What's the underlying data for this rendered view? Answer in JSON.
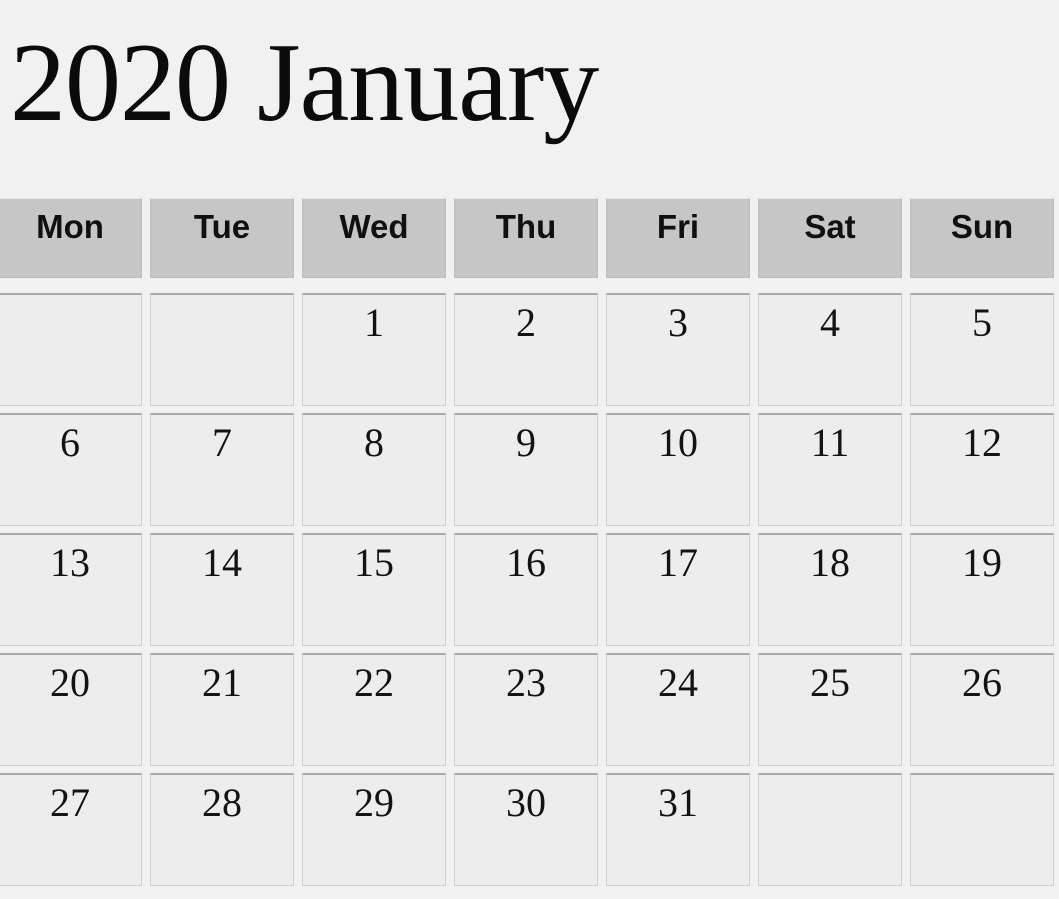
{
  "title": "2020 January",
  "year": "2020",
  "month": "January",
  "colors": {
    "page_background": "#f1f1f1",
    "header_cell_background": "#c6c6c6",
    "day_cell_background": "#ededed",
    "cell_border": "#cfcfcf",
    "text": "#131313"
  },
  "weekday_headers": [
    {
      "label": "Mon"
    },
    {
      "label": "Tue"
    },
    {
      "label": "Wed"
    },
    {
      "label": "Thu"
    },
    {
      "label": "Fri"
    },
    {
      "label": "Sat"
    },
    {
      "label": "Sun"
    }
  ],
  "weeks": [
    {
      "days": [
        {
          "num": ""
        },
        {
          "num": ""
        },
        {
          "num": "1"
        },
        {
          "num": "2"
        },
        {
          "num": "3"
        },
        {
          "num": "4"
        },
        {
          "num": "5"
        }
      ]
    },
    {
      "days": [
        {
          "num": "6"
        },
        {
          "num": "7"
        },
        {
          "num": "8"
        },
        {
          "num": "9"
        },
        {
          "num": "10"
        },
        {
          "num": "11"
        },
        {
          "num": "12"
        }
      ]
    },
    {
      "days": [
        {
          "num": "13"
        },
        {
          "num": "14"
        },
        {
          "num": "15"
        },
        {
          "num": "16"
        },
        {
          "num": "17"
        },
        {
          "num": "18"
        },
        {
          "num": "19"
        }
      ]
    },
    {
      "days": [
        {
          "num": "20"
        },
        {
          "num": "21"
        },
        {
          "num": "22"
        },
        {
          "num": "23"
        },
        {
          "num": "24"
        },
        {
          "num": "25"
        },
        {
          "num": "26"
        }
      ]
    },
    {
      "days": [
        {
          "num": "27"
        },
        {
          "num": "28"
        },
        {
          "num": "29"
        },
        {
          "num": "30"
        },
        {
          "num": "31"
        },
        {
          "num": ""
        },
        {
          "num": ""
        }
      ]
    }
  ]
}
